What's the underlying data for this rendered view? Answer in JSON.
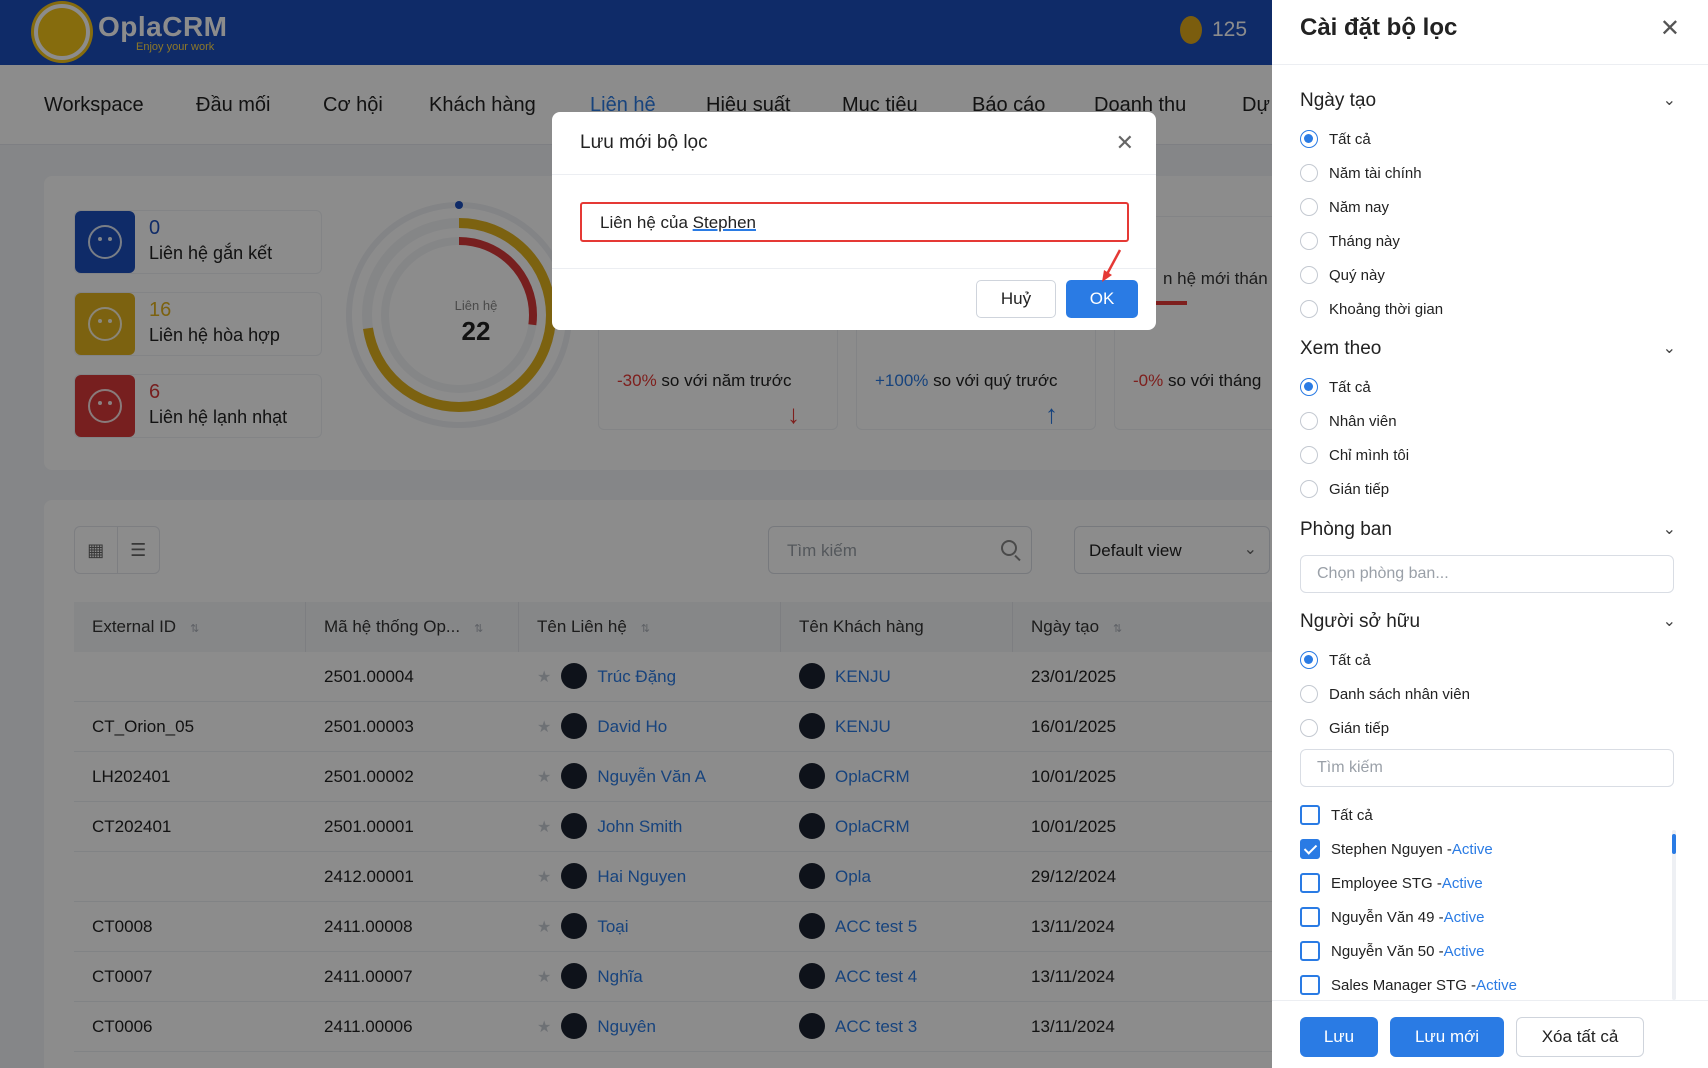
{
  "app": {
    "name": "OplaCRM",
    "tagline": "Enjoy your work",
    "coins": "125"
  },
  "nav": [
    "Workspace",
    "Đầu mối",
    "Cơ hội",
    "Khách hàng",
    "Liên hệ",
    "Hiệu suất",
    "Mục tiêu",
    "Báo cáo",
    "Doanh thu",
    "Dự"
  ],
  "stats": [
    {
      "count": "0",
      "label": "Liên hệ gắn kết",
      "color": "#1d4fbd"
    },
    {
      "count": "16",
      "label": "Liên hệ hòa hợp",
      "color": "#e2b21e"
    },
    {
      "count": "6",
      "label": "Liên hệ lạnh nhạt",
      "color": "#d93a3a"
    }
  ],
  "donut": {
    "label": "Liên hệ",
    "value": "22"
  },
  "compare": [
    {
      "pct": "-30%",
      "text": "so với năm trước",
      "arrow": "↓"
    },
    {
      "pct": "+100%",
      "text": "so với quý trước",
      "arrow": "↑"
    },
    {
      "pct": "-0%",
      "text": "so với tháng",
      "title": "n hệ mới thán"
    }
  ],
  "toolbar": {
    "search_placeholder": "Tìm kiếm",
    "view": "Default view"
  },
  "table": {
    "headers": [
      "External ID",
      "Mã hệ thống Op...",
      "Tên Liên hệ",
      "Tên Khách hàng",
      "Ngày tạo"
    ],
    "rows": [
      {
        "ext": "",
        "code": "2501.00004",
        "name": "Trúc Đặng",
        "company": "KENJU",
        "date": "23/01/2025"
      },
      {
        "ext": "CT_Orion_05",
        "code": "2501.00003",
        "name": "David Ho",
        "company": "KENJU",
        "date": "16/01/2025"
      },
      {
        "ext": "LH202401",
        "code": "2501.00002",
        "name": "Nguyễn Văn A",
        "company": "OplaCRM",
        "date": "10/01/2025"
      },
      {
        "ext": "CT202401",
        "code": "2501.00001",
        "name": "John Smith",
        "company": "OplaCRM",
        "date": "10/01/2025"
      },
      {
        "ext": "",
        "code": "2412.00001",
        "name": "Hai Nguyen",
        "company": "Opla",
        "date": "29/12/2024"
      },
      {
        "ext": "CT0008",
        "code": "2411.00008",
        "name": "Toại",
        "company": "ACC test 5",
        "date": "13/11/2024"
      },
      {
        "ext": "CT0007",
        "code": "2411.00007",
        "name": "Nghĩa",
        "company": "ACC test 4",
        "date": "13/11/2024"
      },
      {
        "ext": "CT0006",
        "code": "2411.00006",
        "name": "Nguyên",
        "company": "ACC test 3",
        "date": "13/11/2024"
      }
    ]
  },
  "panel": {
    "title": "Cài đặt bộ lọc",
    "created": {
      "title": "Ngày tạo",
      "options": [
        "Tất cả",
        "Năm tài chính",
        "Năm nay",
        "Tháng này",
        "Quý này",
        "Khoảng thời gian"
      ]
    },
    "view_by": {
      "title": "Xem theo",
      "options": [
        "Tất cả",
        "Nhân viên",
        "Chỉ mình tôi",
        "Gián tiếp"
      ]
    },
    "department": {
      "title": "Phòng ban",
      "placeholder": "Chọn phòng ban..."
    },
    "owner": {
      "title": "Người sở hữu",
      "options": [
        "Tất cả",
        "Danh sách nhân viên",
        "Gián tiếp"
      ],
      "search_placeholder": "Tìm kiếm",
      "check_all": "Tất cả",
      "people": [
        {
          "name": "Stephen Nguyen - ",
          "status": "Active",
          "checked": true
        },
        {
          "name": "Employee STG - ",
          "status": "Active",
          "checked": false
        },
        {
          "name": "Nguyễn Văn 49 - ",
          "status": "Active",
          "checked": false
        },
        {
          "name": "Nguyễn Văn 50 - ",
          "status": "Active",
          "checked": false
        },
        {
          "name": "Sales Manager STG - ",
          "status": "Active",
          "checked": false
        }
      ]
    },
    "buttons": {
      "save": "Lưu",
      "save_new": "Lưu mới",
      "clear_all": "Xóa tất cả"
    }
  },
  "modal": {
    "title": "Lưu mới bộ lọc",
    "value_prefix": "Liên hệ của ",
    "value_name": "Stephen",
    "cancel": "Huỷ",
    "ok": "OK"
  },
  "colors": {
    "primary": "#2a7be4",
    "header": "#1d4fbd",
    "danger": "#e53935"
  }
}
